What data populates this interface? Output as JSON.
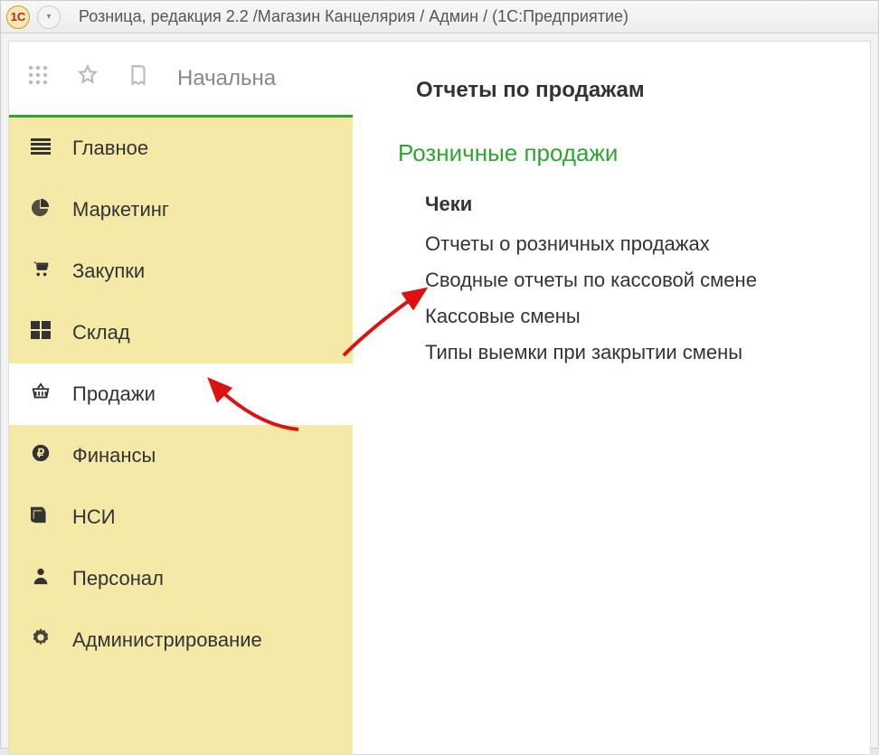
{
  "window": {
    "title": "Розница, редакция 2.2 /Магазин Канцелярия / Админ /  (1С:Предприятие)",
    "logo_text": "1С"
  },
  "toolbar": {
    "tab_label": "Начальна"
  },
  "sidebar": {
    "items": [
      {
        "id": "main",
        "label": "Главное",
        "icon": "hamburger"
      },
      {
        "id": "marketing",
        "label": "Маркетинг",
        "icon": "pie"
      },
      {
        "id": "purchases",
        "label": "Закупки",
        "icon": "cart"
      },
      {
        "id": "warehouse",
        "label": "Склад",
        "icon": "tiles"
      },
      {
        "id": "sales",
        "label": "Продажи",
        "icon": "basket",
        "active": true
      },
      {
        "id": "finance",
        "label": "Финансы",
        "icon": "ruble"
      },
      {
        "id": "nsi",
        "label": "НСИ",
        "icon": "stack"
      },
      {
        "id": "personnel",
        "label": "Персонал",
        "icon": "person"
      },
      {
        "id": "admin",
        "label": "Администрирование",
        "icon": "gear"
      }
    ]
  },
  "panel": {
    "heading": "Отчеты по продажам",
    "section_title": "Розничные продажи",
    "links": [
      {
        "label": "Чеки",
        "bold": true
      },
      {
        "label": "Отчеты о розничных продажах"
      },
      {
        "label": "Сводные отчеты по кассовой смене"
      },
      {
        "label": "Кассовые смены"
      },
      {
        "label": "Типы выемки при закрытии смены"
      }
    ]
  }
}
